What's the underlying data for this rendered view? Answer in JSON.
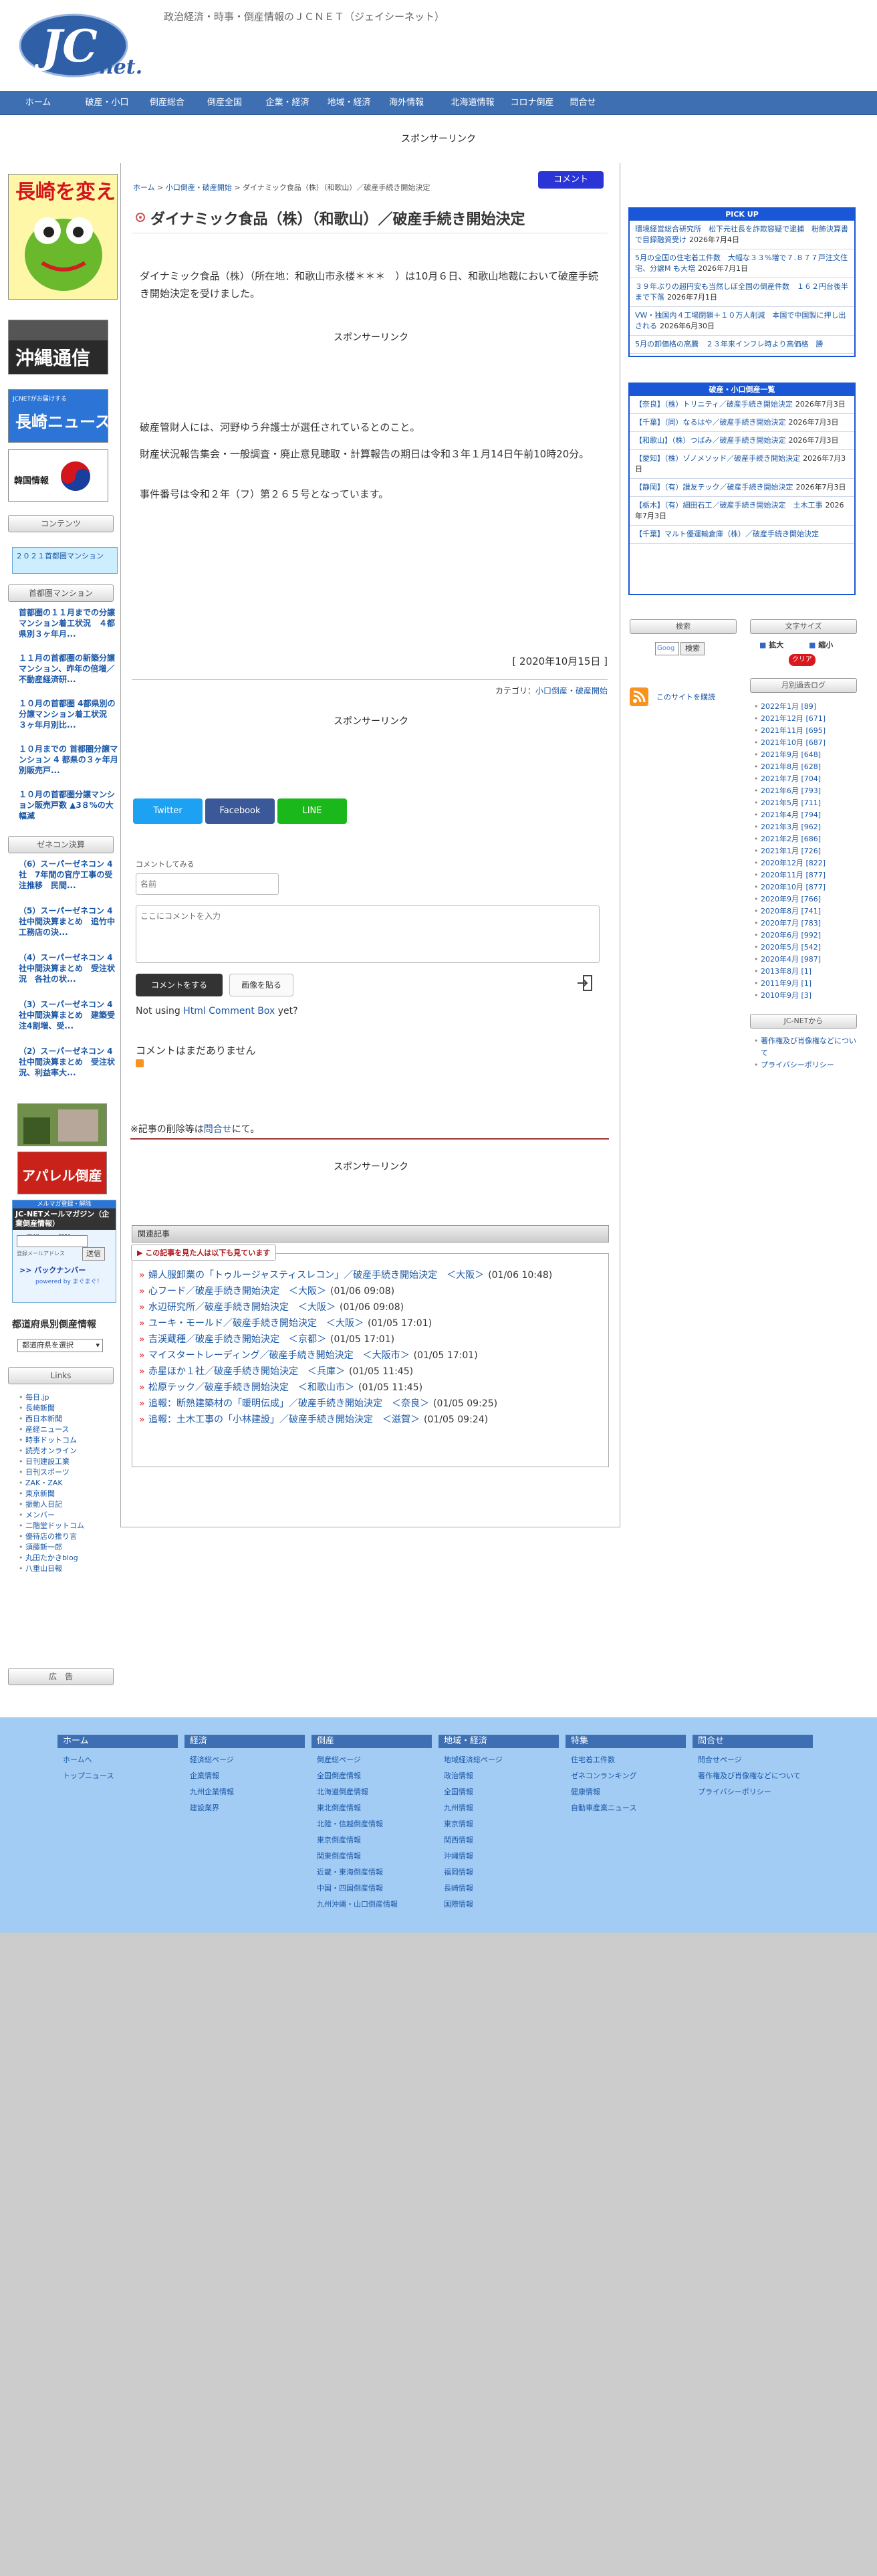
{
  "site": {
    "tagline": "政治経済・時事・倒産情報のＪＣＮＥＴ（ジェイシーネット）",
    "logo_text": "JC",
    "logo_sub": "net."
  },
  "nav": [
    "ホーム",
    "破産・小口",
    "倒産総合",
    "倒産全国",
    "企業・経済",
    "地域・経済",
    "海外情報",
    "北海道情報",
    "コロナ倒産",
    "問合せ"
  ],
  "sponsor": "スポンサーリンク",
  "left": {
    "banners": {
      "nagasaki": "長崎を変える",
      "okinawa": "沖縄通信",
      "nagasaki_news": "長崎ニュース",
      "nagasaki_news_small": "JCNETがお届けする",
      "korea": "韓国情報",
      "apparel": "アパレル倒産"
    },
    "contents_h": "コンテンツ",
    "mansion_link": "２０２１首都圏マンション",
    "mansion_h": "首都圏マンション",
    "mansion_items": [
      "首都圏の１１月までの分譲マンション着工状況　４都県別３ヶ年月...",
      "１１月の首都圏の新築分譲マンション、昨年の倍増／不動産経済研...",
      "１０月の首都圏 4都県別の分譲マンション着工状況　３ヶ年月別比...",
      "１０月までの 首都圏分譲マンション 4 都県の３ヶ年月別販売戸...",
      "１０月の首都圏分譲マンション販売戸数 ▲3８%の大幅減"
    ],
    "zeneco_h": "ゼネコン決算",
    "zeneco_items": [
      "（6）スーパーゼネコン 4社　7年間の官庁工事の受注推移　民間...",
      "（5）スーパーゼネコン 4社中間決算まとめ　追竹中工務店の決...",
      "（4）スーパーゼネコン 4社中間決算まとめ　受注状況　各社の状...",
      "（3）スーパーゼネコン 4社中間決算まとめ　建築受注4割増、受...",
      "（2）スーパーゼネコン 4社中間決算まとめ　受注状況、利益率大..."
    ],
    "mail": {
      "title": "JC-NETメールマガジン（企業倒産情報）",
      "sub": "メルマガ登録・解除",
      "radio1": "登録",
      "radio2": "解除",
      "submit": "送信",
      "backnumber": ">> バックナンバー",
      "powered": "powered by まぐまぐ！"
    },
    "pref_h": "都道府県別倒産情報",
    "pref_select": "都道府県を選択",
    "links_h": "Links",
    "links": [
      "毎日.jp",
      "長崎新聞",
      "西日本新聞",
      "産経ニュース",
      "時事ドットコム",
      "読売オンライン",
      "日刊建設工業",
      "日刊スポーツ",
      "ZAK・ZAK",
      "東京新聞",
      "振動人日記",
      "メンバー",
      "二階堂ドットコム",
      "優待店の推り言",
      "須藤新一郎",
      "丸田たかきblog",
      "八重山日報"
    ],
    "ad_h": "広　告"
  },
  "main": {
    "comment_btn": "コメント",
    "breadcrumb": [
      "ホーム",
      "小口倒産・破産開始",
      "ダイナミック食品（株）（和歌山）／破産手続き開始決定"
    ],
    "title": "ダイナミック食品（株）（和歌山）／破産手続き開始決定",
    "p1": "ダイナミック食品（株）（所在地：和歌山市永楼＊＊＊　）は10月６日、和歌山地裁において破産手続き開始決定を受けました。",
    "sponsor": "スポンサーリンク",
    "p2": "破産管財人には、河野ゆう弁護士が選任されているとのこと。",
    "p3": "財産状況報告集会・一般調査・廃止意見聴取・計算報告の期日は令和３年１月14日午前10時20分。",
    "p4": "事件番号は令和２年（フ）第２６５号となっています。",
    "date": "[ 2020年10月15日 ]",
    "category_label": "カテゴリ：",
    "category": "小口倒産・破産開始",
    "share": {
      "twitter": "Twitter",
      "facebook": "Facebook",
      "line": "LINE"
    },
    "comment_prompt": "コメントしてみる",
    "name_ph": "名前",
    "comment_ph": "ここにコメントを入力",
    "submit_comment": "コメントをする",
    "paste_image": "画像を貼る",
    "not_using": "Not using",
    "html_comment_box": "Html Comment Box",
    "yet": "yet?",
    "no_comments": "コメントはまだありません",
    "delete_note_a": "※記事の削除等は",
    "delete_note_link": "問合せ",
    "delete_note_b": "にて。",
    "related_h": "関連記事",
    "related_sub": "この記事を見た人は以下も見ています",
    "related": [
      {
        "t": "婦人服卸業の「トゥルージャスティスレコン」／破産手続き開始決定　＜大阪＞",
        "d": "(01/06 10:48)"
      },
      {
        "t": "心フード／破産手続き開始決定　＜大阪＞",
        "d": "(01/06 09:08)"
      },
      {
        "t": "水辺研究所／破産手続き開始決定　＜大阪＞",
        "d": "(01/06 09:08)"
      },
      {
        "t": "ユーキ・モールド／破産手続き開始決定　＜大阪＞",
        "d": "(01/05 17:01)"
      },
      {
        "t": "吉渓蔵種／破産手続き開始決定　＜京都＞",
        "d": "(01/05 17:01)"
      },
      {
        "t": "マイスタートレーディング／破産手続き開始決定　＜大阪市＞",
        "d": "(01/05 17:01)"
      },
      {
        "t": "赤星ほか１社／破産手続き開始決定　＜兵庫＞",
        "d": "(01/05 11:45)"
      },
      {
        "t": "松原テック／破産手続き開始決定　＜和歌山市＞",
        "d": "(01/05 11:45)"
      },
      {
        "t": "追報：断熱建築材の「暖明伝成」／破産手続き開始決定　＜奈良＞",
        "d": "(01/05 09:25)"
      },
      {
        "t": "追報：土木工事の「小林建設」／破産手続き開始決定　＜滋賀＞",
        "d": "(01/05 09:24)"
      }
    ]
  },
  "right": {
    "pickup_h": "PICK UP",
    "pickup": [
      {
        "t": "環境経営総合研究所　松下元社長を詐欺容疑で逮捕　粉飾決算書で目録融資受け",
        "d": "2026年7月4日"
      },
      {
        "t": "5月の全国の住宅着工件数　大幅な３３%増で７.８７７戸注文住宅、分譲M も大増",
        "d": "2026年7月1日"
      },
      {
        "t": "３９年ぶりの超円安も当然しぼ全国の倒産件数　１６２円台後半まで下落",
        "d": "2026年7月1日"
      },
      {
        "t": "VW・独国内４工場閉鎖＋１０万人削減　本国で中国製に押し出される",
        "d": "2026年6月30日"
      },
      {
        "t": "5月の卸価格の高騰　２３年来インフレ時より高価格　勝",
        "d": ""
      }
    ],
    "hasan_h": "破産・小口倒産一覧",
    "hasan": [
      {
        "t": "【奈良】（株）トリニティ／破産手続き開始決定",
        "d": "2026年7月3日"
      },
      {
        "t": "【千葉】（同）なるはや／破産手続き開始決定",
        "d": "2026年7月3日"
      },
      {
        "t": "【和歌山】（株）つばみ／破産手続き開始決定",
        "d": "2026年7月3日"
      },
      {
        "t": "【愛知】（株）ゾノメソッド／破産手続き開始決定",
        "d": "2026年7月3日"
      },
      {
        "t": "【静岡】（有）讃友テック／破産手続き開始決定",
        "d": "2026年7月3日"
      },
      {
        "t": "【栃木】（有）細田石工／破産手続き開始決定　土木工事",
        "d": "2026年7月3日"
      },
      {
        "t": "【千葉】マルト優運輸倉庫（株）／破産手続き開始決定",
        "d": ""
      }
    ],
    "search_h": "検索",
    "search_btn": "検索",
    "rss_label": "このサイトを購読",
    "fontsize_h": "文字サイズ",
    "fs_big": "拡大",
    "fs_small": "縮小",
    "fs_clear": "クリア",
    "archive_h": "月別過去ログ",
    "archives": [
      "2022年1月 [89]",
      "2021年12月 [671]",
      "2021年11月 [695]",
      "2021年10月 [687]",
      "2021年9月 [648]",
      "2021年8月 [628]",
      "2021年7月 [704]",
      "2021年6月 [793]",
      "2021年5月 [711]",
      "2021年4月 [794]",
      "2021年3月 [962]",
      "2021年2月 [686]",
      "2021年1月 [726]",
      "2020年12月 [822]",
      "2020年11月 [877]",
      "2020年10月 [877]",
      "2020年9月 [766]",
      "2020年8月 [741]",
      "2020年7月 [783]",
      "2020年6月 [992]",
      "2020年5月 [542]",
      "2020年4月 [987]",
      "2013年8月 [1]",
      "2011年9月 [1]",
      "2010年9月 [3]"
    ],
    "jcnet_h": "JC-NETから",
    "jcnet": [
      "著作権及び肖像権などについて",
      "プライバシーポリシー"
    ]
  },
  "footer": [
    {
      "h": "ホーム",
      "items": [
        "ホームへ",
        "トップニュース"
      ]
    },
    {
      "h": "経済",
      "items": [
        "経済総ページ",
        "企業情報",
        "九州企業情報",
        "建設業界"
      ]
    },
    {
      "h": "倒産",
      "items": [
        "倒産総ページ",
        "全国倒産情報",
        "北海道倒産情報",
        "東北倒産情報",
        "北陸・信越倒産情報",
        "東京倒産情報",
        "関東倒産情報",
        "近畿・東海倒産情報",
        "中国・四国倒産情報",
        "九州沖縄・山口倒産情報"
      ]
    },
    {
      "h": "地域・経済",
      "items": [
        "地域経済総ページ",
        "政治情報",
        "全国情報",
        "九州情報",
        "東京情報",
        "関西情報",
        "沖縄情報",
        "福岡情報",
        "長崎情報",
        "国際情報"
      ]
    },
    {
      "h": "特集",
      "items": [
        "住宅着工件数",
        "ゼネコンランキング",
        "健康情報",
        "自動車産業ニュース"
      ]
    },
    {
      "h": "問合せ",
      "items": [
        "問合せページ",
        "著作権及び肖像権などについて",
        "プライバシーポリシー"
      ]
    }
  ]
}
